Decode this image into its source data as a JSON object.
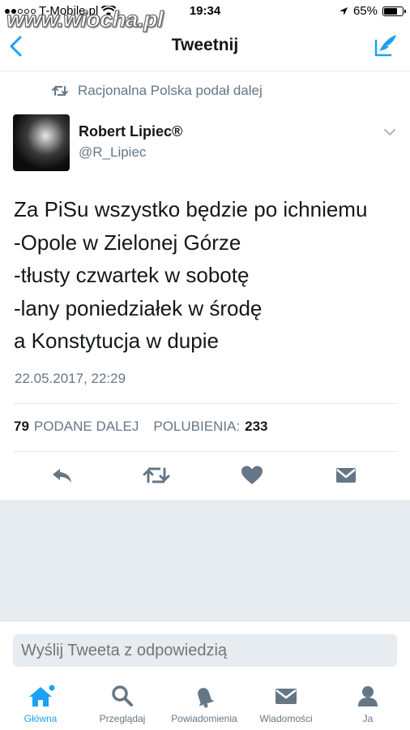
{
  "status_bar": {
    "carrier": "T-Mobile.pl",
    "time": "19:34",
    "battery": "65%",
    "battery_level": 0.65
  },
  "watermark": "www.wiocha.pl",
  "header": {
    "title": "Tweetnij"
  },
  "tweet": {
    "retweeted_by": "Racjonalna Polska podał dalej",
    "author_name": "Robert Lipiec®",
    "author_handle": "@R_Lipiec",
    "lines": [
      "Za PiSu wszystko będzie po ichniemu",
      "-Opole w Zielonej Górze",
      "-tłusty czwartek w sobotę",
      "-lany poniedziałek w środę",
      "a Konstytucja w dupie"
    ],
    "timestamp": "22.05.2017, 22:29",
    "retweets_count": "79",
    "retweets_label": "PODANE DALEJ",
    "likes_label": "POLUBIENIA:",
    "likes_count": "233"
  },
  "reply": {
    "placeholder": "Wyślij Tweeta z odpowiedzią"
  },
  "tabs": [
    {
      "label": "Główna",
      "icon": "home-icon",
      "active": true
    },
    {
      "label": "Przeglądaj",
      "icon": "search-icon",
      "active": false
    },
    {
      "label": "Powiadomienia",
      "icon": "bell-icon",
      "active": false
    },
    {
      "label": "Wiadomości",
      "icon": "envelope-icon",
      "active": false
    },
    {
      "label": "Ja",
      "icon": "person-icon",
      "active": false
    }
  ],
  "colors": {
    "accent": "#1da1f2",
    "secondary_text": "#657786",
    "primary_text": "#14171a",
    "background_gray": "#e6ecf0"
  }
}
